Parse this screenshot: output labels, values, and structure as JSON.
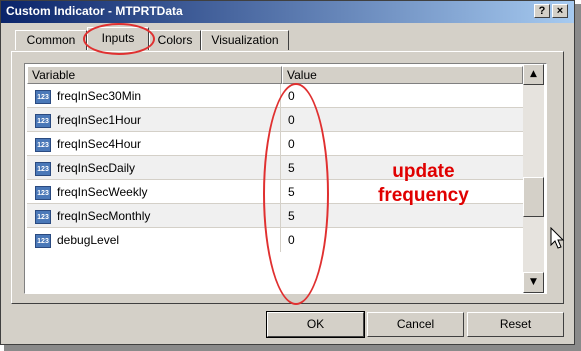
{
  "window": {
    "title": "Custom Indicator - MTPRTData",
    "help_label": "?",
    "close_label": "×"
  },
  "tabs": [
    {
      "label": "Common"
    },
    {
      "label": "Inputs",
      "active": true
    },
    {
      "label": "Colors"
    },
    {
      "label": "Visualization"
    }
  ],
  "grid": {
    "headers": {
      "variable": "Variable",
      "value": "Value"
    },
    "icon_text": "123",
    "rows": [
      {
        "variable": "freqInSec30Min",
        "value": "0"
      },
      {
        "variable": "freqInSec1Hour",
        "value": "0"
      },
      {
        "variable": "freqInSec4Hour",
        "value": "0"
      },
      {
        "variable": "freqInSecDaily",
        "value": "5"
      },
      {
        "variable": "freqInSecWeekly",
        "value": "5"
      },
      {
        "variable": "freqInSecMonthly",
        "value": "5"
      },
      {
        "variable": "debugLevel",
        "value": "0"
      }
    ]
  },
  "buttons": {
    "ok": "OK",
    "cancel": "Cancel",
    "reset": "Reset"
  },
  "annotation": {
    "line1": "update",
    "line2": "frequency",
    "color": "#e00000"
  },
  "colors": {
    "title_start": "#0a246a",
    "title_end": "#a6caf0",
    "dialog_bg": "#d4d0c8",
    "highlight": "#e03030"
  }
}
